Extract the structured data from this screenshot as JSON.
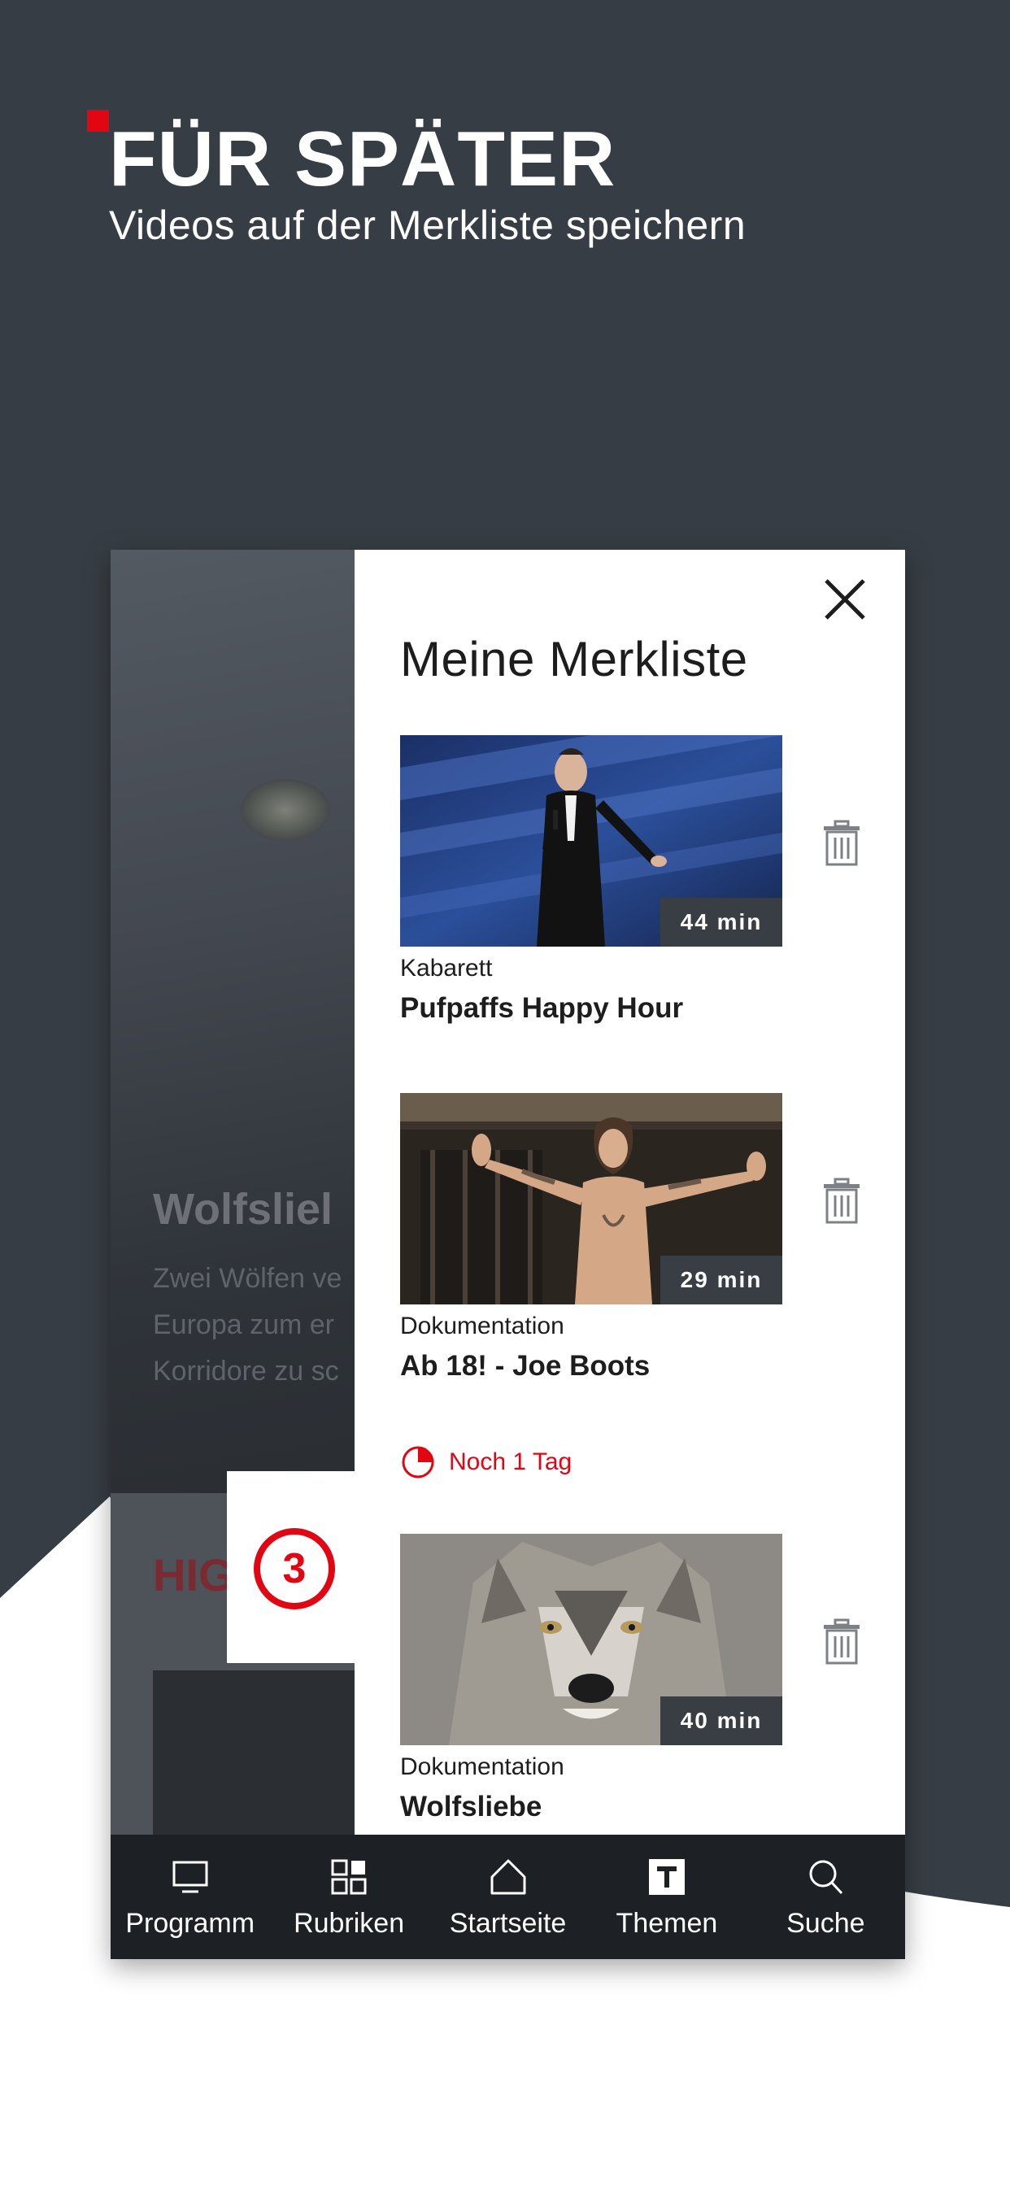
{
  "colors": {
    "backdrop": "#373d44",
    "accent": "#e20613",
    "nav_background": "#1d2125",
    "badge_background": "#393e45"
  },
  "promo": {
    "headline": "FÜR SPÄTER",
    "subline": "Videos auf der Merkliste speichern"
  },
  "background_screen": {
    "title": "Wolfsliel",
    "description": "Zwei Wölfen ve\nEuropa zum er\nKorridore zu sc",
    "section_label": "HIG",
    "channel_logo": "3"
  },
  "drawer": {
    "title": "Meine Merkliste",
    "close_icon": "close-icon",
    "delete_icon": "trash-icon",
    "items": [
      {
        "duration": "44 min",
        "category": "Kabarett",
        "title": "Pufpaffs Happy Hour",
        "thumbnail": "comedian-on-stage"
      },
      {
        "duration": "29 min",
        "category": "Dokumentation",
        "title": "Ab 18! - Joe Boots",
        "thumbnail": "tattooed-man-arms-spread"
      },
      {
        "duration": "40 min",
        "category": "Dokumentation",
        "title": "Wolfsliebe",
        "thumbnail": "grey-wolf-portrait"
      }
    ],
    "expiry": {
      "icon": "clock-icon",
      "text": "Noch 1 Tag"
    }
  },
  "nav": {
    "items": [
      {
        "label": "Programm",
        "icon": "tv-icon"
      },
      {
        "label": "Rubriken",
        "icon": "grid-icon"
      },
      {
        "label": "Startseite",
        "icon": "home-icon"
      },
      {
        "label": "Themen",
        "icon": "t-icon"
      },
      {
        "label": "Suche",
        "icon": "search-icon"
      }
    ]
  }
}
